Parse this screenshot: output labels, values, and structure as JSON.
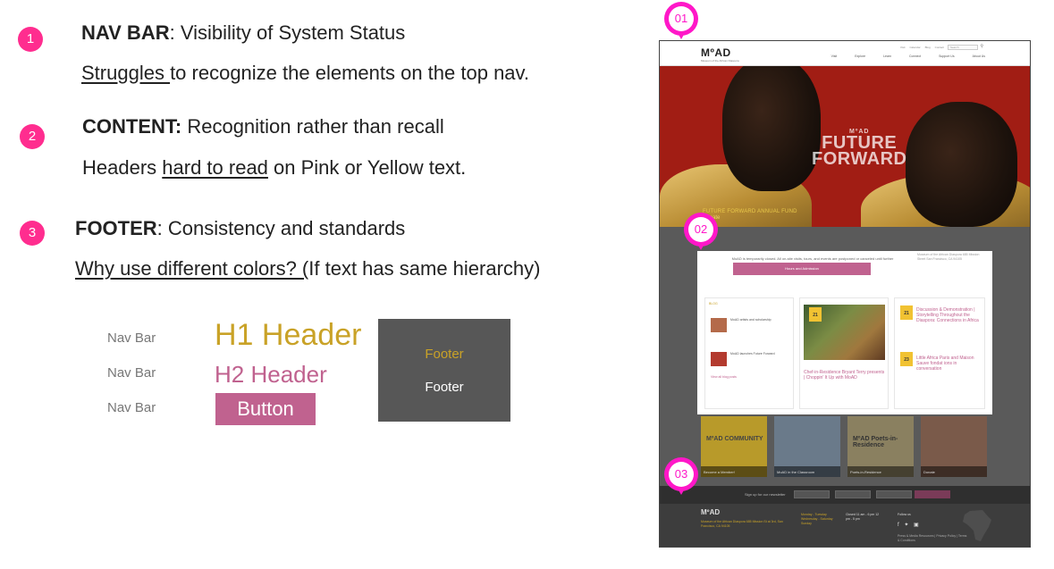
{
  "notes": [
    {
      "badge": "1",
      "title_bold": "NAV BAR",
      "title_rest": ": Visibility of System Status",
      "desc_underlined": "Struggles ",
      "desc_rest": "to recognize the elements on the top nav."
    },
    {
      "badge": "2",
      "title_bold": "CONTENT:",
      "title_rest": " Recognition rather than recall",
      "desc_pre": "Headers ",
      "desc_underlined": "hard to read",
      "desc_rest": " on Pink or Yellow text."
    },
    {
      "badge": "3",
      "title_bold": "FOOTER",
      "title_rest": ": Consistency and standards",
      "desc_underlined": "Why use different colors? (",
      "desc_rest": "If text has same hierarchy)"
    }
  ],
  "style_sample": {
    "nav_labels": [
      "Nav Bar",
      "Nav Bar",
      "Nav Bar"
    ],
    "h1": "H1 Header",
    "h2": "H2 Header",
    "button": "Button",
    "footer_gold": "Footer",
    "footer_white": "Footer"
  },
  "pins": [
    "01",
    "02",
    "03"
  ],
  "site": {
    "logo": "MºAD",
    "logo_sub": "Museum of the African Diaspora",
    "util_links": [
      "Visit",
      "Calendar",
      "Blog",
      "Contact"
    ],
    "search_placeholder": "Search",
    "main_nav": [
      "Visit",
      "Explore",
      "Learn",
      "Connect",
      "Support Us",
      "About Us"
    ],
    "hero_brand": "MºAD",
    "hero_line1": "FUTURE",
    "hero_line2": "FORWARD",
    "promo_title": "FUTURE FORWARD ANNUAL FUND",
    "promo_sub": "Donate",
    "notice": "MoAD is temporarily closed. All on-site visits, tours, and events are postponed or canceled until further notice. See our online programs here.",
    "notice_button": "Hours and Admission",
    "side_info": "Museum of the African Diaspora 685 Mission Street San Francisco, CA 94105",
    "blog_label": "BLOG",
    "blog_items": [
      "MoAD artists and scholarship",
      "MoAD launches Future Forward"
    ],
    "blog_more": "View all blog posts",
    "event_date_1": "21",
    "event_date_2": "21",
    "event_date_3": "23",
    "event_title_1": "Chef-in-Residence Bryant Terry presents | Choppin' It Up with MoAD",
    "event_title_2": "Discussion & Demonstration | Storytelling Throughout the Diaspora: Connections in Africa",
    "event_title_3": "Little Africa Paris and Maison Sauve fondat ions in conversation",
    "tiles": [
      "Become a Member!",
      "MoAD in the Classroom",
      "Poets-in-Residence",
      "Donate"
    ],
    "tile_caption_1": "MºAD COMMUNITY",
    "tile_caption_3": "MºAD Poets-in-Residence",
    "newsletter_label": "Sign up for our newsletter",
    "footer_logo": "MºAD",
    "footer_address": "Museum of the African Diaspora 685 Mission St at 3rd, San Francisco, CA 94105",
    "footer_hours_title": "Monday - Tuesday Wednesday - Saturday Sunday",
    "footer_hours": "Closed 11 am - 6 pm 12 pm - 5 pm",
    "footer_follow": "Follow us",
    "footer_social": "f ✦ ▣",
    "footer_links": "Press & Media Resources | Privacy Policy | Terms & Conditions"
  },
  "colors": {
    "badge": "#ff2d8f",
    "pin": "#ff17c8",
    "gold": "#c9a227",
    "pink": "#c0628f",
    "hero_red": "#a11d14",
    "footer_grey": "#575757"
  }
}
